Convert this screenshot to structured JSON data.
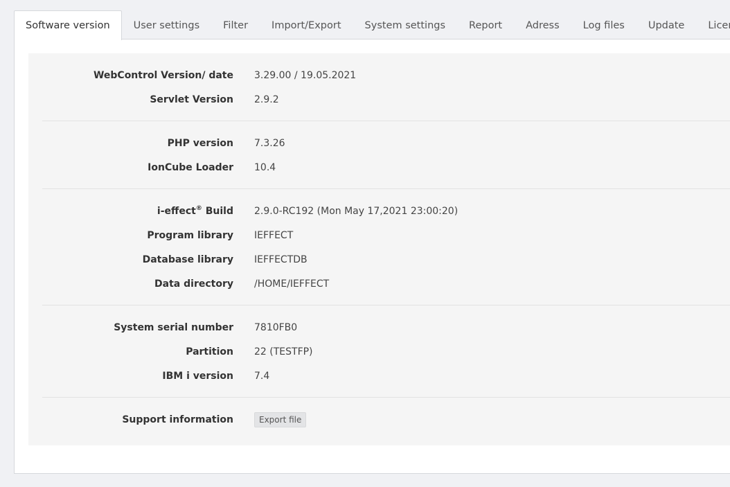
{
  "tabs": [
    {
      "label": "Software version",
      "active": true
    },
    {
      "label": "User settings"
    },
    {
      "label": "Filter"
    },
    {
      "label": "Import/Export"
    },
    {
      "label": "System settings"
    },
    {
      "label": "Report"
    },
    {
      "label": "Adress"
    },
    {
      "label": "Log files"
    },
    {
      "label": "Update"
    },
    {
      "label": "Licenses"
    }
  ],
  "info": {
    "webcontrol": {
      "label": "WebControl Version/ date",
      "value": "3.29.00 / 19.05.2021"
    },
    "servlet": {
      "label": "Servlet Version",
      "value": "2.9.2"
    },
    "php": {
      "label": "PHP version",
      "value": "7.3.26"
    },
    "ioncube": {
      "label": "IonCube Loader",
      "value": "10.4"
    },
    "build": {
      "label_prefix": "i-effect",
      "label_sup": "®",
      "label_suffix": " Build",
      "value": "2.9.0-RC192 (Mon May 17,2021 23:00:20)"
    },
    "program_library": {
      "label": "Program library",
      "value": "IEFFECT"
    },
    "database_library": {
      "label": "Database library",
      "value": "IEFFECTDB"
    },
    "data_directory": {
      "label": "Data directory",
      "value": "/HOME/IEFFECT"
    },
    "serial": {
      "label": "System serial number",
      "value": "7810FB0"
    },
    "partition": {
      "label": "Partition",
      "value": "22 (TESTFP)"
    },
    "ibmi": {
      "label": "IBM i version",
      "value": "7.4"
    },
    "support": {
      "label": "Support information",
      "button": "Export file"
    }
  }
}
